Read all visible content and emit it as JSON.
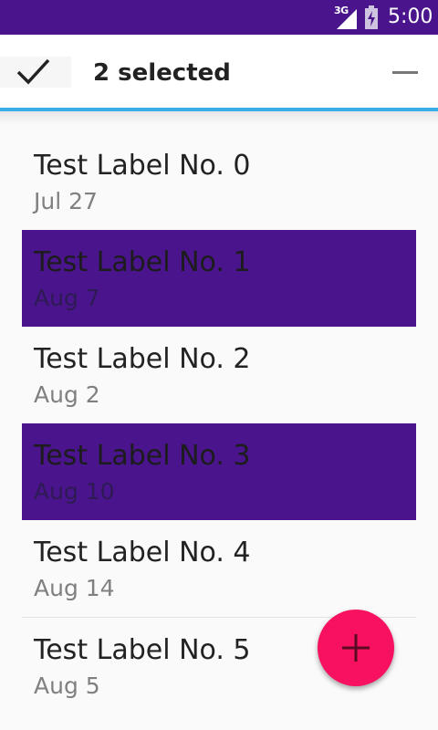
{
  "status_bar": {
    "network": "3G",
    "time": "5:00",
    "background": "#4a158c"
  },
  "action_bar": {
    "title": "2 selected",
    "done_icon": "check-icon",
    "remove_icon": "minus-icon",
    "accent_underline": "#3aace6"
  },
  "list": {
    "items": [
      {
        "label": "Test Label No. 0",
        "date": "Jul 27",
        "selected": false
      },
      {
        "label": "Test Label No. 1",
        "date": "Aug 7",
        "selected": true
      },
      {
        "label": "Test Label No. 2",
        "date": "Aug 2",
        "selected": false
      },
      {
        "label": "Test Label No. 3",
        "date": "Aug 10",
        "selected": true
      },
      {
        "label": "Test Label No. 4",
        "date": "Aug 14",
        "selected": false
      },
      {
        "label": "Test Label No. 5",
        "date": "Aug 5",
        "selected": false
      }
    ],
    "selected_color": "#4a158c"
  },
  "fab": {
    "icon": "plus-icon",
    "color": "#f81160"
  }
}
